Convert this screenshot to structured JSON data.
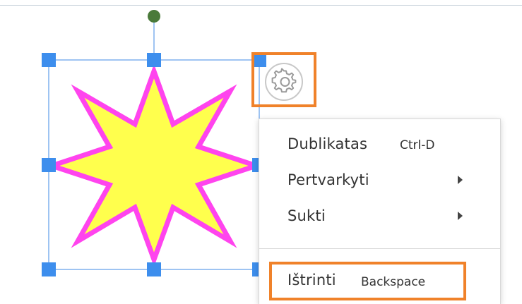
{
  "canvas": {
    "selected_shape": {
      "type": "eight-point-star",
      "fill_color": "#ffff4d",
      "stroke_color": "#ff44ee",
      "selection_color": "#3d8eed",
      "rotate_handle_color": "#4a7a3a"
    },
    "gear_icon": "gear-icon",
    "highlight_color": "#f0822a"
  },
  "context_menu": {
    "items": [
      {
        "label": "Dublikatas",
        "shortcut": "Ctrl-D",
        "has_submenu": false
      },
      {
        "label": "Pertvarkyti",
        "shortcut": "",
        "has_submenu": true
      },
      {
        "label": "Sukti",
        "shortcut": "",
        "has_submenu": true
      },
      {
        "label": "Ištrinti",
        "shortcut": "Backspace",
        "has_submenu": false
      }
    ]
  }
}
